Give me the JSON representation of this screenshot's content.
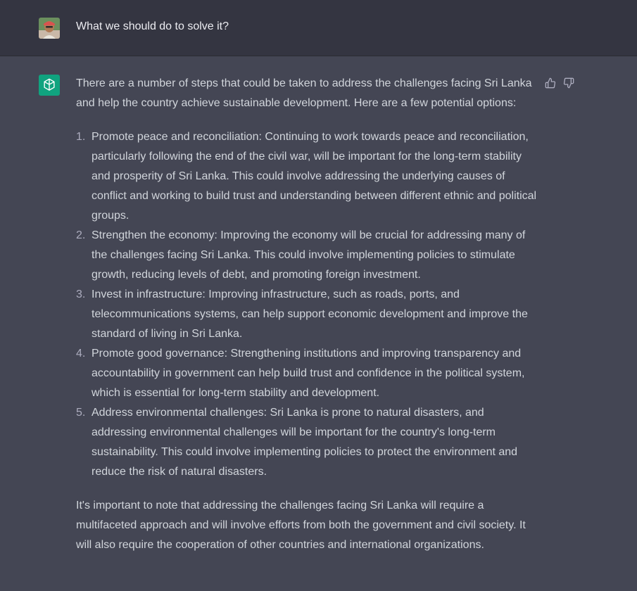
{
  "user": {
    "avatar_icon": "user-avatar-photo",
    "message": "What we should do to solve it?"
  },
  "assistant": {
    "icon": "openai-logo-icon",
    "brand_color": "#10a37f",
    "intro": "There are a number of steps that could be taken to address the challenges facing Sri Lanka and help the country achieve sustainable development. Here are a few potential options:",
    "steps": [
      {
        "num": "1.",
        "text": "Promote peace and reconciliation: Continuing to work towards peace and reconciliation, particularly following the end of the civil war, will be important for the long-term stability and prosperity of Sri Lanka. This could involve addressing the underlying causes of conflict and working to build trust and understanding between different ethnic and political groups."
      },
      {
        "num": "2.",
        "text": "Strengthen the economy: Improving the economy will be crucial for addressing many of the challenges facing Sri Lanka. This could involve implementing policies to stimulate growth, reducing levels of debt, and promoting foreign investment."
      },
      {
        "num": "3.",
        "text": "Invest in infrastructure: Improving infrastructure, such as roads, ports, and telecommunications systems, can help support economic development and improve the standard of living in Sri Lanka."
      },
      {
        "num": "4.",
        "text": "Promote good governance: Strengthening institutions and improving transparency and accountability in government can help build trust and confidence in the political system, which is essential for long-term stability and development."
      },
      {
        "num": "5.",
        "text": "Address environmental challenges: Sri Lanka is prone to natural disasters, and addressing environmental challenges will be important for the country's long-term sustainability. This could involve implementing policies to protect the environment and reduce the risk of natural disasters."
      }
    ],
    "outro": "It's important to note that addressing the challenges facing Sri Lanka will require a multifaceted approach and will involve efforts from both the government and civil society. It will also require the cooperation of other countries and international organizations.",
    "feedback": {
      "up_icon": "thumbs-up-icon",
      "down_icon": "thumbs-down-icon"
    }
  }
}
